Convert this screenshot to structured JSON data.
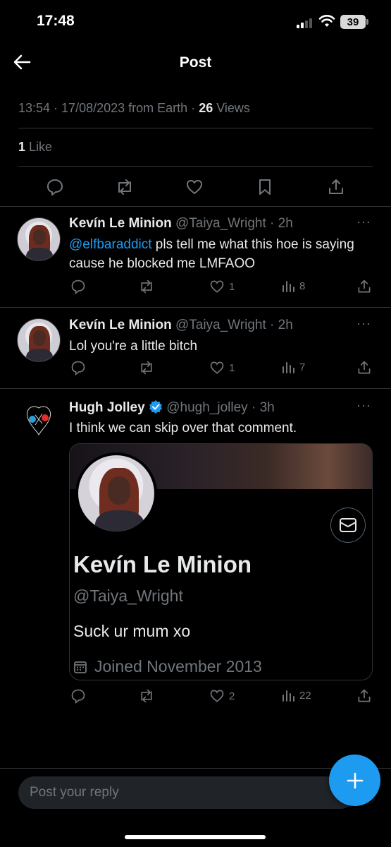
{
  "status_bar": {
    "time": "17:48",
    "battery": "39"
  },
  "header": {
    "title": "Post"
  },
  "post_meta": {
    "time": "13:54",
    "date": "17/08/2023",
    "source": "from Earth",
    "views_count": "26",
    "views_label": "Views"
  },
  "likes": {
    "count": "1",
    "label": "Like"
  },
  "replies": [
    {
      "name": "Kevín Le Minion",
      "handle": "@Taiya_Wright",
      "age": "2h",
      "mention": "@elfbaraddict",
      "text": " pls tell me what this hoe is saying cause he blocked me LMFAOO",
      "likes": "1",
      "views": "8"
    },
    {
      "name": "Kevín Le Minion",
      "handle": "@Taiya_Wright",
      "age": "2h",
      "text": "Lol you're a little bitch",
      "likes": "1",
      "views": "7"
    },
    {
      "name": "Hugh Jolley",
      "handle": "@hugh_jolley",
      "age": "3h",
      "text": "I think we can skip over that comment.",
      "likes": "2",
      "views": "22",
      "verified": true
    }
  ],
  "profile_card": {
    "name": "Kevín Le Minion",
    "handle": "@Taiya_Wright",
    "bio": "Suck ur mum xo",
    "joined": "Joined November 2013"
  },
  "reply_bar": {
    "placeholder": "Post your reply"
  },
  "colors": {
    "accent": "#1d9bf0",
    "muted": "#71767b",
    "text": "#e7e9ea",
    "divider": "#2f3336"
  }
}
